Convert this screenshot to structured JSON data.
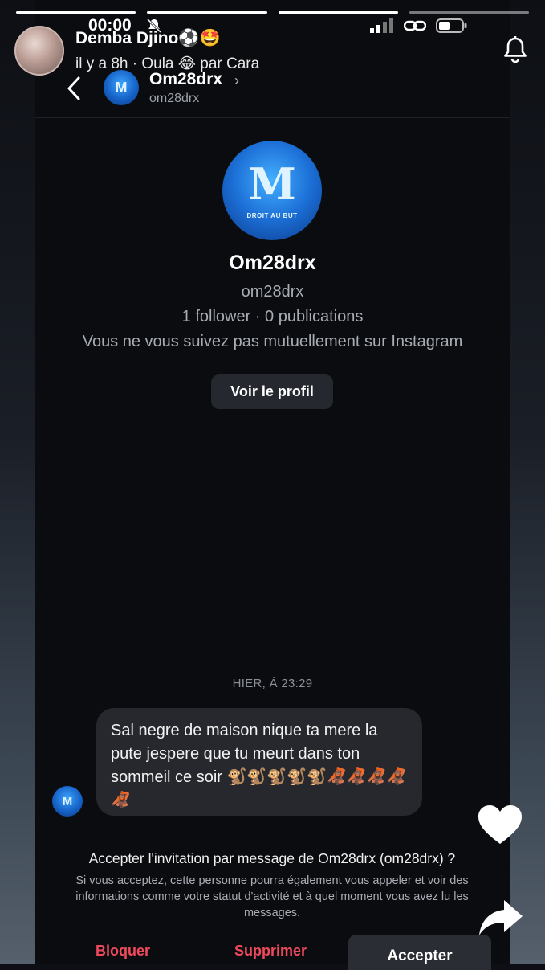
{
  "story": {
    "user_name": "Demba Djino⚽️🤩",
    "subtitle": "il y a 8h · Oula 😂 par Cara",
    "progress_segments": 4,
    "progress_active_index": 3
  },
  "status_bar": {
    "time": "00:00"
  },
  "dm": {
    "name": "Om28drx",
    "handle": "om28drx",
    "avatar_logo": "M"
  },
  "profile": {
    "name": "Om28drx",
    "handle": "om28drx",
    "stats": "1 follower · 0 publications",
    "mutual_text": "Vous ne vous suivez pas mutuellement sur Instagram",
    "view_profile_label": "Voir le profil",
    "logo_letter": "M",
    "logo_motto": "DROIT AU BUT"
  },
  "message": {
    "timestamp": "HIER, À 23:29",
    "text": "Sal negre de maison nique ta mere la pute jespere que tu meurt dans ton sommeil ce soir 🐒🐒🐒🐒🐒🦧🦧🦧🦧🦧"
  },
  "request": {
    "title": "Accepter l'invitation par message de Om28drx (om28drx) ?",
    "description": "Si vous acceptez, cette personne pourra également vous appeler et voir des informations comme votre statut d'activité et à quel moment vous avez lu les messages.",
    "block_label": "Bloquer",
    "delete_label": "Supprimer",
    "accept_label": "Accepter"
  },
  "colors": {
    "danger": "#ef4a5c",
    "bubble": "#26282d",
    "button": "#2a2d33",
    "secondary_text": "#a8adb4"
  },
  "icons": [
    "mute-bell-icon",
    "signal-icon",
    "link-icon",
    "battery-icon",
    "bell-icon",
    "back-chevron-icon",
    "heart-icon",
    "share-icon"
  ]
}
